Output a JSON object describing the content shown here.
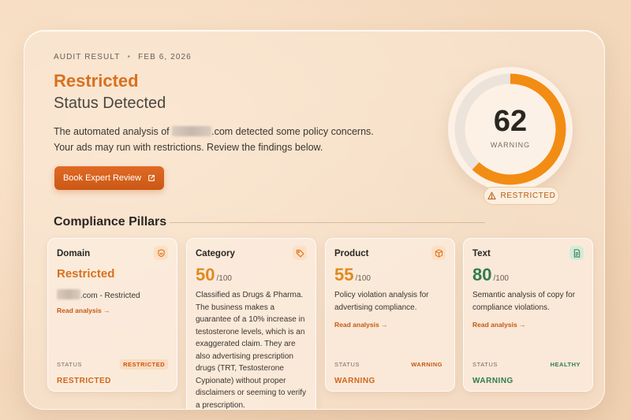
{
  "audit": {
    "label": "AUDIT RESULT",
    "separator": "•",
    "date": "FEB 6, 2026"
  },
  "headline": "Restricted",
  "subheadline": "Status Detected",
  "description": {
    "part1": "The automated analysis of",
    "part2": ".com detected some policy concerns. Your ads may run with restrictions. Review the findings below."
  },
  "cta": {
    "label": "Book Expert Review",
    "icon": "external-link-icon"
  },
  "gauge": {
    "score": "62",
    "max": 100,
    "label": "WARNING",
    "color": "#f28c13",
    "track_color": "#ece3da"
  },
  "status_pill": {
    "label": "RESTRICTED",
    "icon": "warning-triangle-icon"
  },
  "section_title": "Compliance Pillars",
  "pillars": [
    {
      "title": "Domain",
      "icon": "shield-icon",
      "headline": "Restricted",
      "domain_suffix": ".com - Restricted",
      "link": "Read analysis →",
      "status_label": "STATUS",
      "status_badge": "RESTRICTED",
      "status_value": "RESTRICTED"
    },
    {
      "title": "Category",
      "icon": "tag-icon",
      "score": "50",
      "of": "/100",
      "description": "Classified as Drugs & Pharma. The business makes a guarantee of a 10% increase in testosterone levels, which is an exaggerated claim. They are also advertising prescription drugs (TRT, Testosterone Cypionate) without proper disclaimers or seeming to verify a prescription."
    },
    {
      "title": "Product",
      "icon": "box-icon",
      "score": "55",
      "of": "/100",
      "description": "Policy violation analysis for advertising compliance.",
      "link": "Read analysis →",
      "status_label": "STATUS",
      "status_badge": "WARNING",
      "status_value": "WARNING"
    },
    {
      "title": "Text",
      "icon": "document-icon",
      "score": "80",
      "of": "/100",
      "description": "Semantic analysis of copy for compliance violations.",
      "link": "Read analysis →",
      "status_label": "STATUS",
      "status_badge": "HEALTHY",
      "status_value": "WARNING"
    }
  ],
  "colors": {
    "accent": "#d8711f",
    "button": "#d9621c",
    "healthy": "#2f7d4f"
  }
}
